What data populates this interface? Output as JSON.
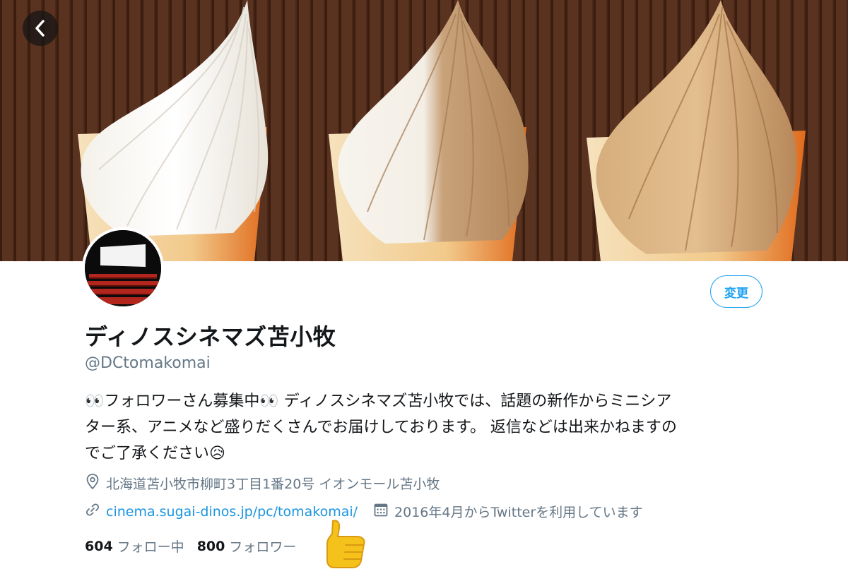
{
  "profile": {
    "display_name": "ディノスシネマズ苫小牧",
    "handle": "@DCtomakomai",
    "bio_lines": [
      "👀フォロワーさん募集中👀 ディノスシネマズ苫小牧では、話題の新作からミニシア",
      "ター系、アニメなど盛りだくさんでお届けしております。 返信などは出来かねますの",
      "でご了承ください😥"
    ],
    "location": "北海道苫小牧市柳町3丁目1番20号 イオンモール苫小牧",
    "website": "cinema.sugai-dinos.jp/pc/tomakomai/",
    "joined": "2016年4月からTwitterを利用しています"
  },
  "stats": {
    "following_count": "604",
    "following_label": "フォロー中",
    "followers_count": "800",
    "followers_label": "フォロワー"
  },
  "actions": {
    "edit_label": "変更"
  },
  "icons": {
    "back": "chevron-left-icon",
    "location": "map-pin-icon",
    "link": "link-icon",
    "calendar": "calendar-icon",
    "thumbs": "thumbs-up-emoji"
  },
  "colors": {
    "accent": "#1da1f2",
    "link": "#1b95e0",
    "muted": "#657786",
    "text": "#14171a",
    "banner_bg": "#4a2716"
  }
}
